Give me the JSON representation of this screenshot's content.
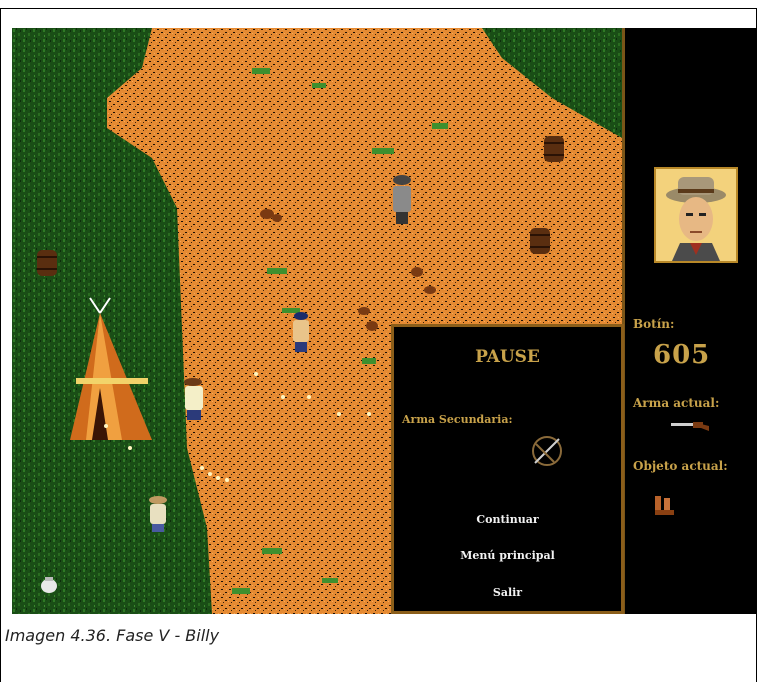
{
  "caption": "Imagen 4.36. Fase V - Billy",
  "hud": {
    "loot_label": "Botín:",
    "loot_value": "605",
    "weapon_label": "Arma actual:",
    "weapon_icon": "rifle-icon",
    "object_label": "Objeto actual:",
    "object_icon": "boots-icon"
  },
  "pause_menu": {
    "title": "PAUSE",
    "secondary_weapon_label": "Arma Secundaria:",
    "secondary_weapon_icon": "crossbow-icon",
    "buttons": [
      "Continuar",
      "Menú principal",
      "Salir"
    ]
  },
  "colors": {
    "grass": "#1f5a1a",
    "dirt": "#e58a32",
    "hud_gold": "#c8a24a",
    "panel_border": "#8b5e1a"
  }
}
